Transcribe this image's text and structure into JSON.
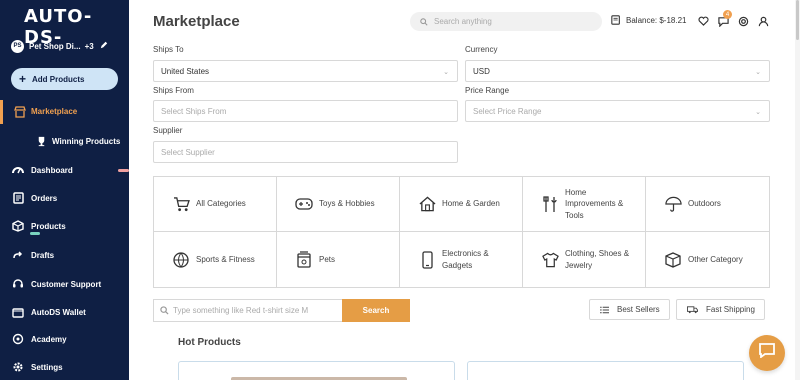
{
  "app": {
    "logo": "AUTO-DS-"
  },
  "store": {
    "avatar": "PS",
    "name": "Pet Shop Di...",
    "count": "+3"
  },
  "sidebar": {
    "add_products": "Add Products",
    "items": [
      {
        "label": "Marketplace",
        "icon": "shop-icon"
      },
      {
        "label": "Winning Products",
        "icon": "trophy-icon"
      },
      {
        "label": "Dashboard",
        "icon": "dashboard-icon"
      },
      {
        "label": "Orders",
        "icon": "orders-icon"
      },
      {
        "label": "Products",
        "icon": "box-icon"
      },
      {
        "label": "Drafts",
        "icon": "drafts-icon"
      },
      {
        "label": "Customer Support",
        "icon": "headset-icon"
      },
      {
        "label": "AutoDS Wallet",
        "icon": "wallet-icon"
      },
      {
        "label": "Academy",
        "icon": "academy-icon"
      },
      {
        "label": "Settings",
        "icon": "gear-icon"
      }
    ],
    "accent": "#f0a050",
    "background": "#0f1f44"
  },
  "header": {
    "title": "Marketplace",
    "search_placeholder": "Search anything",
    "balance": "Balance: $-18.21",
    "notification_count": "4"
  },
  "filters": {
    "ships_to": {
      "label": "Ships To",
      "value": "United States"
    },
    "currency": {
      "label": "Currency",
      "value": "USD"
    },
    "ships_from": {
      "label": "Ships From",
      "placeholder": "Select Ships From"
    },
    "price_range": {
      "label": "Price Range",
      "placeholder": "Select Price Range"
    },
    "supplier": {
      "label": "Supplier",
      "placeholder": "Select Supplier"
    }
  },
  "categories": [
    {
      "label": "All Categories",
      "icon": "cart-icon"
    },
    {
      "label": "Toys & Hobbies",
      "icon": "gamepad-icon"
    },
    {
      "label": "Home & Garden",
      "icon": "house-icon"
    },
    {
      "label": "Home Improvements & Tools",
      "icon": "tools-icon"
    },
    {
      "label": "Outdoors",
      "icon": "umbrella-icon"
    },
    {
      "label": "Sports & Fitness",
      "icon": "ball-icon"
    },
    {
      "label": "Pets",
      "icon": "pet-food-icon"
    },
    {
      "label": "Electronics & Gadgets",
      "icon": "phone-icon"
    },
    {
      "label": "Clothing, Shoes & Jewelry",
      "icon": "shirt-icon"
    },
    {
      "label": "Other Category",
      "icon": "package-icon"
    }
  ],
  "product_search": {
    "placeholder": "Type something like Red t-shirt size M",
    "button": "Search"
  },
  "quick_filters": {
    "best_sellers": "Best Sellers",
    "fast_shipping": "Fast Shipping"
  },
  "hot_products": {
    "title": "Hot Products"
  },
  "colors": {
    "primary_button": "#e59d45"
  }
}
